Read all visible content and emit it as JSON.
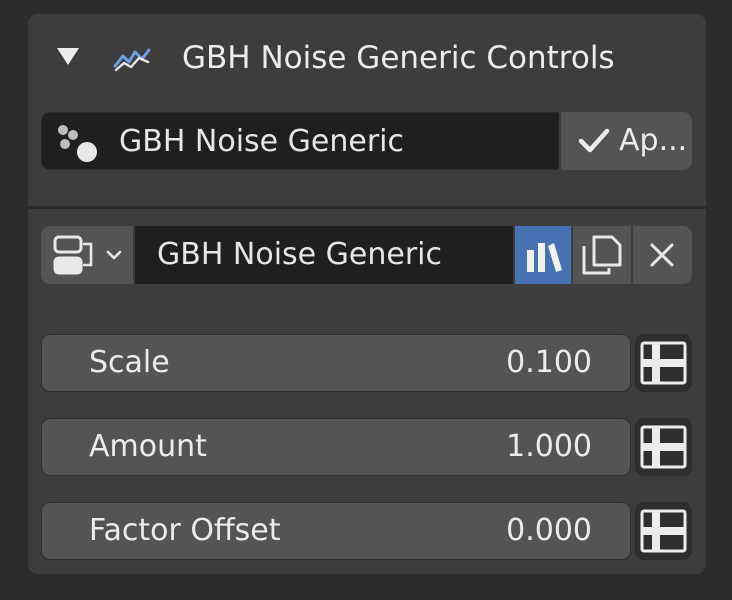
{
  "panel": {
    "title": "GBH Noise Generic Controls",
    "collapse_icon": "triangle-down-icon",
    "node_icon": "geometry-nodes-icon"
  },
  "modifier": {
    "name": "GBH Noise Generic",
    "icon": "modifier-dots-icon",
    "apply_label": "Ap...",
    "apply_icon": "checkmark-icon"
  },
  "node_group": {
    "name": "GBH Noise Generic",
    "browse_icon": "node-tree-browse-icon",
    "fake_user_icon": "fake-user-icon",
    "fake_user_active": true,
    "duplicate_icon": "duplicate-icon",
    "unlink_icon": "close-icon"
  },
  "properties": [
    {
      "label": "Scale",
      "value": "0.100"
    },
    {
      "label": "Amount",
      "value": "1.000"
    },
    {
      "label": "Factor Offset",
      "value": "0.000"
    }
  ],
  "colors": {
    "panel_bg": "#3d3d3d",
    "field_dark": "#1f1f1f",
    "button_bg": "#545454",
    "active_blue": "#4772b3",
    "text": "#e6e6e6"
  }
}
